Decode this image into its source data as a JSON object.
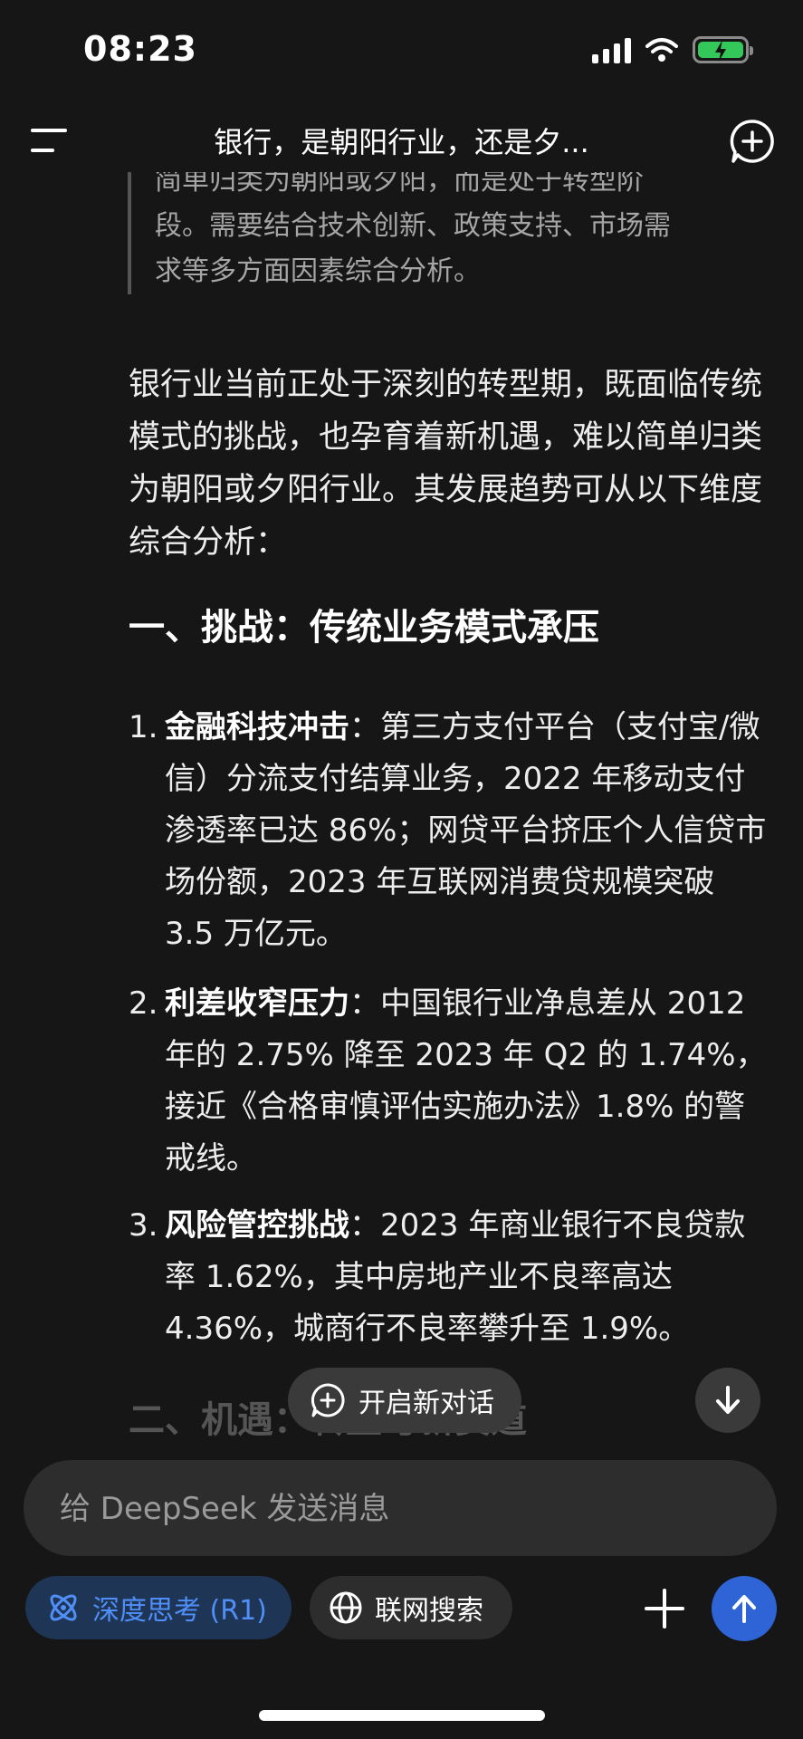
{
  "status_bar": {
    "time": "08:23",
    "battery_color": "#34c759"
  },
  "header": {
    "title": "银行，是朝阳行业，还是夕..."
  },
  "quote": {
    "lines": [
      "简单归类为朝阳或夕阳，而是处于转型阶",
      "段。需要结合技术创新、政策支持、市场需",
      "求等多方面因素综合分析。"
    ]
  },
  "intro": "银行业当前正处于深刻的转型期，既面临传统模式的挑战，也孕育着新机遇，难以简单归类为朝阳或夕阳行业。其发展趋势可从以下维度综合分析：",
  "section1": {
    "heading": "一、挑战：传统业务模式承压"
  },
  "items": [
    {
      "num": "1.",
      "title": "金融科技冲击",
      "text": "：第三方支付平台（支付宝/微信）分流支付结算业务，2022 年移动支付渗透率已达 86%；网贷平台挤压个人信贷市场份额，2023 年互联网消费贷规模突破 3.5 万亿元。"
    },
    {
      "num": "2.",
      "title": "利差收窄压力",
      "text": "：中国银行业净息差从 2012 年的 2.75% 降至 2023 年 Q2 的 1.74%，接近《合格审慎评估实施办法》1.8% 的警戒线。"
    },
    {
      "num": "3.",
      "title": "风险管控挑战",
      "text": "：2023 年商业银行不良贷款率 1.62%，其中房地产业不良率高达 4.36%，城商行不良率攀升至 1.9%。"
    }
  ],
  "section2": {
    "heading": "二、机遇：转型与新赛道"
  },
  "floating": {
    "new_chat_label": "开启新对话"
  },
  "composer": {
    "placeholder": "给 DeepSeek 发送消息"
  },
  "toolbar": {
    "deep_think_label": "深度思考 (R1)",
    "web_search_label": "联网搜索"
  },
  "colors": {
    "accent_blue": "#4f8ff7",
    "send_button": "#2f64d6",
    "background": "#161616"
  }
}
